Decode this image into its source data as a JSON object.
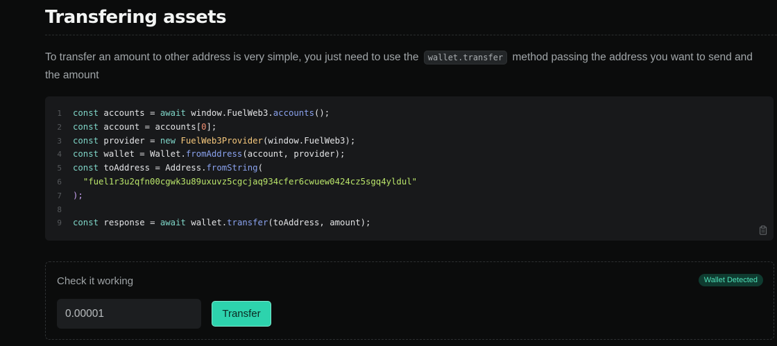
{
  "section": {
    "title": "Transfering assets",
    "intro_before": "To transfer an amount to other address is very simple, you just need to use the ",
    "intro_code": "wallet.transfer",
    "intro_after": " method passing the address you want to send and the amount"
  },
  "code": {
    "lines": [
      {
        "num": "1",
        "tokens": [
          {
            "t": "const",
            "c": "kw"
          },
          {
            "t": " accounts = ",
            "c": ""
          },
          {
            "t": "await",
            "c": "kw"
          },
          {
            "t": " window.FuelWeb3.",
            "c": ""
          },
          {
            "t": "accounts",
            "c": "fn"
          },
          {
            "t": "();",
            "c": ""
          }
        ]
      },
      {
        "num": "2",
        "tokens": [
          {
            "t": "const",
            "c": "kw"
          },
          {
            "t": " account = accounts[",
            "c": ""
          },
          {
            "t": "0",
            "c": "num"
          },
          {
            "t": "];",
            "c": ""
          }
        ]
      },
      {
        "num": "3",
        "tokens": [
          {
            "t": "const",
            "c": "kw"
          },
          {
            "t": " provider = ",
            "c": ""
          },
          {
            "t": "new",
            "c": "kw"
          },
          {
            "t": " ",
            "c": ""
          },
          {
            "t": "FuelWeb3Provider",
            "c": "cls"
          },
          {
            "t": "(window.FuelWeb3);",
            "c": ""
          }
        ]
      },
      {
        "num": "4",
        "tokens": [
          {
            "t": "const",
            "c": "kw"
          },
          {
            "t": " wallet = Wallet.",
            "c": ""
          },
          {
            "t": "fromAddress",
            "c": "fn"
          },
          {
            "t": "(account, provider);",
            "c": ""
          }
        ]
      },
      {
        "num": "5",
        "tokens": [
          {
            "t": "const",
            "c": "kw"
          },
          {
            "t": " toAddress = Address.",
            "c": ""
          },
          {
            "t": "fromString",
            "c": "fn"
          },
          {
            "t": "(",
            "c": ""
          }
        ]
      },
      {
        "num": "6",
        "tokens": [
          {
            "t": "  ",
            "c": ""
          },
          {
            "t": "\"fuel1r3u2qfn00cgwk3u89uxuvz5cgcjaq934cfer6cwuew0424cz5sgq4yldul\"",
            "c": "str"
          }
        ]
      },
      {
        "num": "7",
        "tokens": [
          {
            "t": ");",
            "c": "pn"
          }
        ]
      },
      {
        "num": "8",
        "tokens": []
      },
      {
        "num": "9",
        "tokens": [
          {
            "t": "const",
            "c": "kw"
          },
          {
            "t": " response = ",
            "c": ""
          },
          {
            "t": "await",
            "c": "kw"
          },
          {
            "t": " wallet.",
            "c": ""
          },
          {
            "t": "transfer",
            "c": "fn"
          },
          {
            "t": "(toAddress, amount);",
            "c": ""
          }
        ]
      }
    ],
    "copy_icon": "clipboard-icon"
  },
  "demo": {
    "title": "Check it working",
    "badge": "Wallet Detected",
    "amount_value": "0.00001",
    "transfer_label": "Transfer"
  },
  "colors": {
    "background": "#0b0c0c",
    "code_background": "#18191b",
    "accent": "#2dd3ad",
    "badge_text": "#4fe0b8",
    "badge_background": "#0f3b30"
  }
}
